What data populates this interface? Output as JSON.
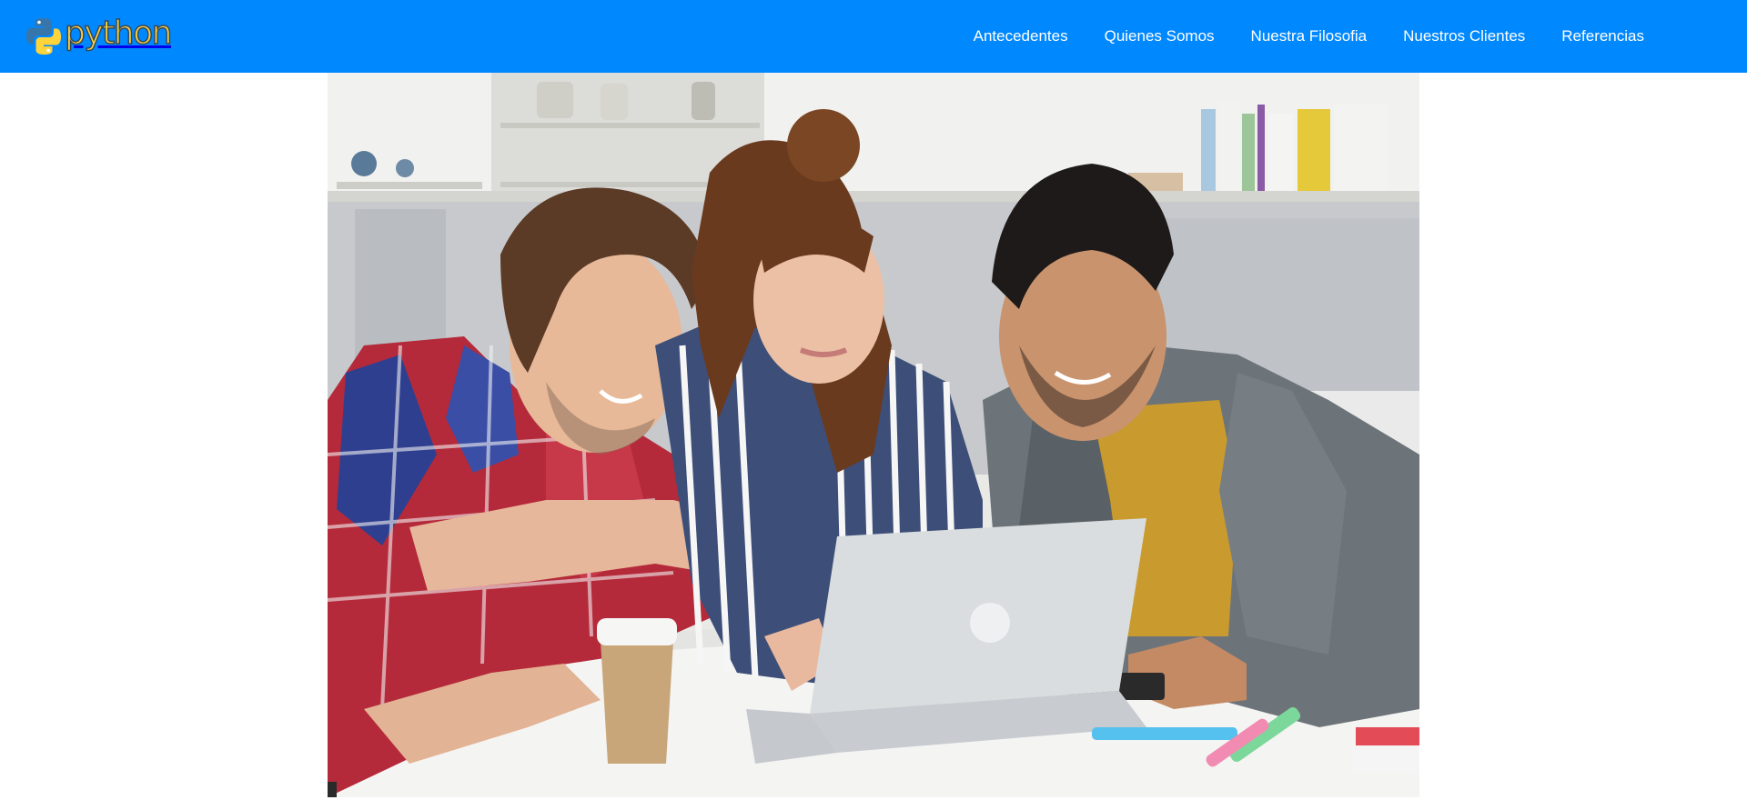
{
  "header": {
    "logo": {
      "icon": "python-logo-icon",
      "text": "python"
    },
    "nav": [
      {
        "label": "Antecedentes"
      },
      {
        "label": "Quienes Somos"
      },
      {
        "label": "Nuestra Filosofia"
      },
      {
        "label": "Nuestros Clientes"
      },
      {
        "label": "Referencias"
      }
    ]
  },
  "hero": {
    "image": "hero-photo-students-laptop"
  },
  "colors": {
    "navbar_bg": "#0088ff",
    "nav_text": "#ffffff",
    "logo_blue": "#3776ab",
    "logo_yellow": "#ffd43b",
    "page_bg": "#ffffff"
  }
}
